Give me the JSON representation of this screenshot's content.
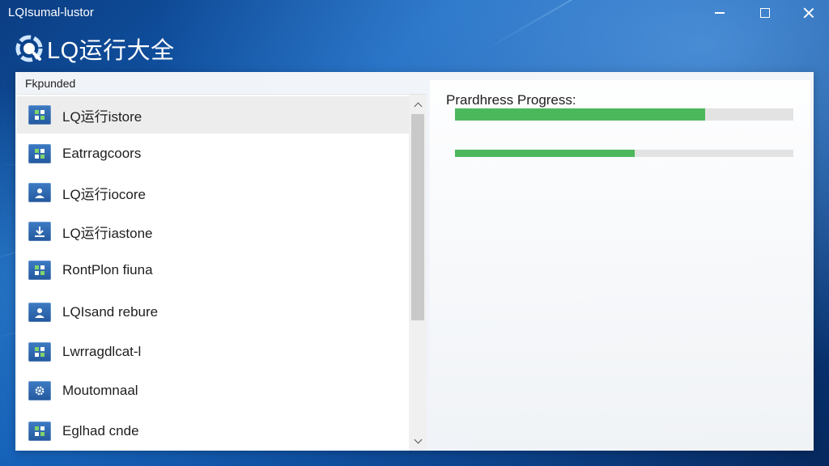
{
  "window": {
    "title": "LQIsumal-lustor",
    "controls": [
      "minimize",
      "maximize",
      "close"
    ]
  },
  "app": {
    "title": "LQ运行大全",
    "logo_icon": "app-logo-icon"
  },
  "list_section": {
    "label": "Fkpunded",
    "items": [
      {
        "label": "LQ运行istore",
        "icon": "grid-icon",
        "selected": true
      },
      {
        "label": "Eatrragcoors",
        "icon": "grid-icon",
        "selected": false
      },
      {
        "label": "LQ运行iocore",
        "icon": "user-icon",
        "selected": false
      },
      {
        "label": "LQ运行iastone",
        "icon": "download-icon",
        "selected": false
      },
      {
        "label": "RontPlon fiuna",
        "icon": "grid-icon",
        "selected": false
      },
      {
        "label": "LQIsand rebure",
        "icon": "user-icon",
        "selected": false
      },
      {
        "label": "Lwrragdlcat-l",
        "icon": "grid-icon",
        "selected": false
      },
      {
        "label": "Moutomnaal",
        "icon": "gear-icon",
        "selected": false
      },
      {
        "label": "Eglhad cnde",
        "icon": "grid-icon",
        "selected": false
      }
    ]
  },
  "progress_section": {
    "title": "Prardhress Progress:",
    "bars": [
      {
        "value": 0.74
      },
      {
        "value": 0.53
      }
    ]
  },
  "colors": {
    "accent_green": "#4cb85c",
    "icon_blue": "#2f6ab3",
    "background_blue": "#1460b8"
  }
}
